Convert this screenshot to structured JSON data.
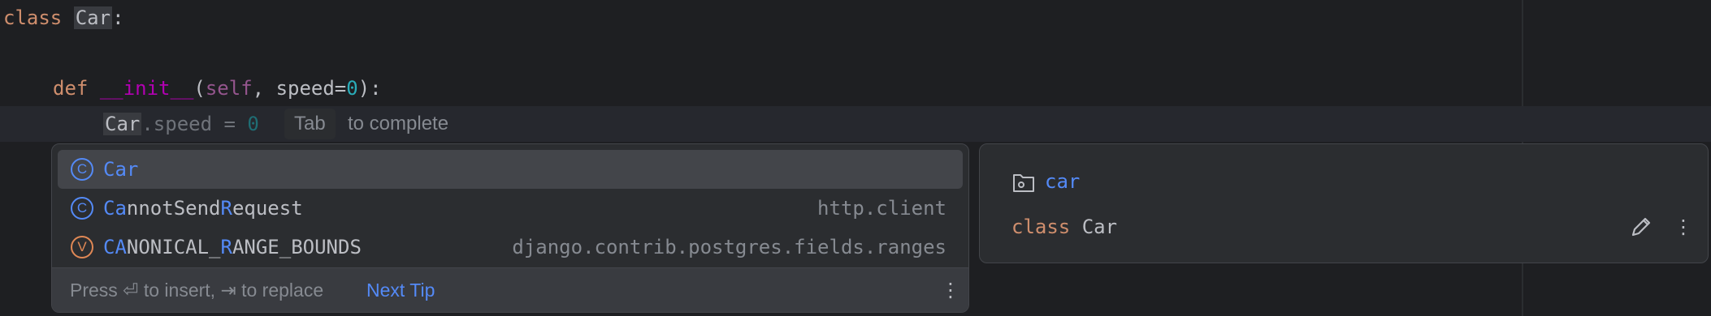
{
  "editor": {
    "line1": {
      "keyword": "class",
      "name": "Car",
      "colon": ":"
    },
    "line3": {
      "keyword": "def",
      "fn": "__init__",
      "open": "(",
      "self": "self",
      "sep": ", ",
      "param": "speed=",
      "default": "0",
      "close": "):"
    },
    "line4": {
      "typed": "Car",
      "ghost_attr": ".speed = ",
      "ghost_value": "0"
    },
    "hint": {
      "key": "Tab",
      "text": "to complete"
    }
  },
  "completion": {
    "items": [
      {
        "icon": "class-icon",
        "icon_letter": "C",
        "name_match": "Car",
        "name_rest": "",
        "type": ""
      },
      {
        "icon": "class-icon",
        "icon_letter": "C",
        "name_parts": [
          "Ca",
          "nnotSend",
          "R",
          "equest"
        ],
        "type": "http.client"
      },
      {
        "icon": "variable-icon",
        "icon_letter": "V",
        "name_parts": [
          "CA",
          "NONICAL_",
          "R",
          "ANGE_BOUNDS"
        ],
        "type": "django.contrib.postgres.fields.ranges"
      }
    ],
    "footer": {
      "text": "Press ⏎ to insert, ⇥ to replace",
      "link": "Next Tip",
      "menu": "⋮"
    }
  },
  "doc": {
    "module": "car",
    "keyword": "class",
    "name": "Car",
    "menu": "⋮"
  },
  "colors": {
    "accent": "#548af7",
    "keyword": "#cf8e6d",
    "background": "#1e1f22",
    "popup": "#2b2d30"
  }
}
